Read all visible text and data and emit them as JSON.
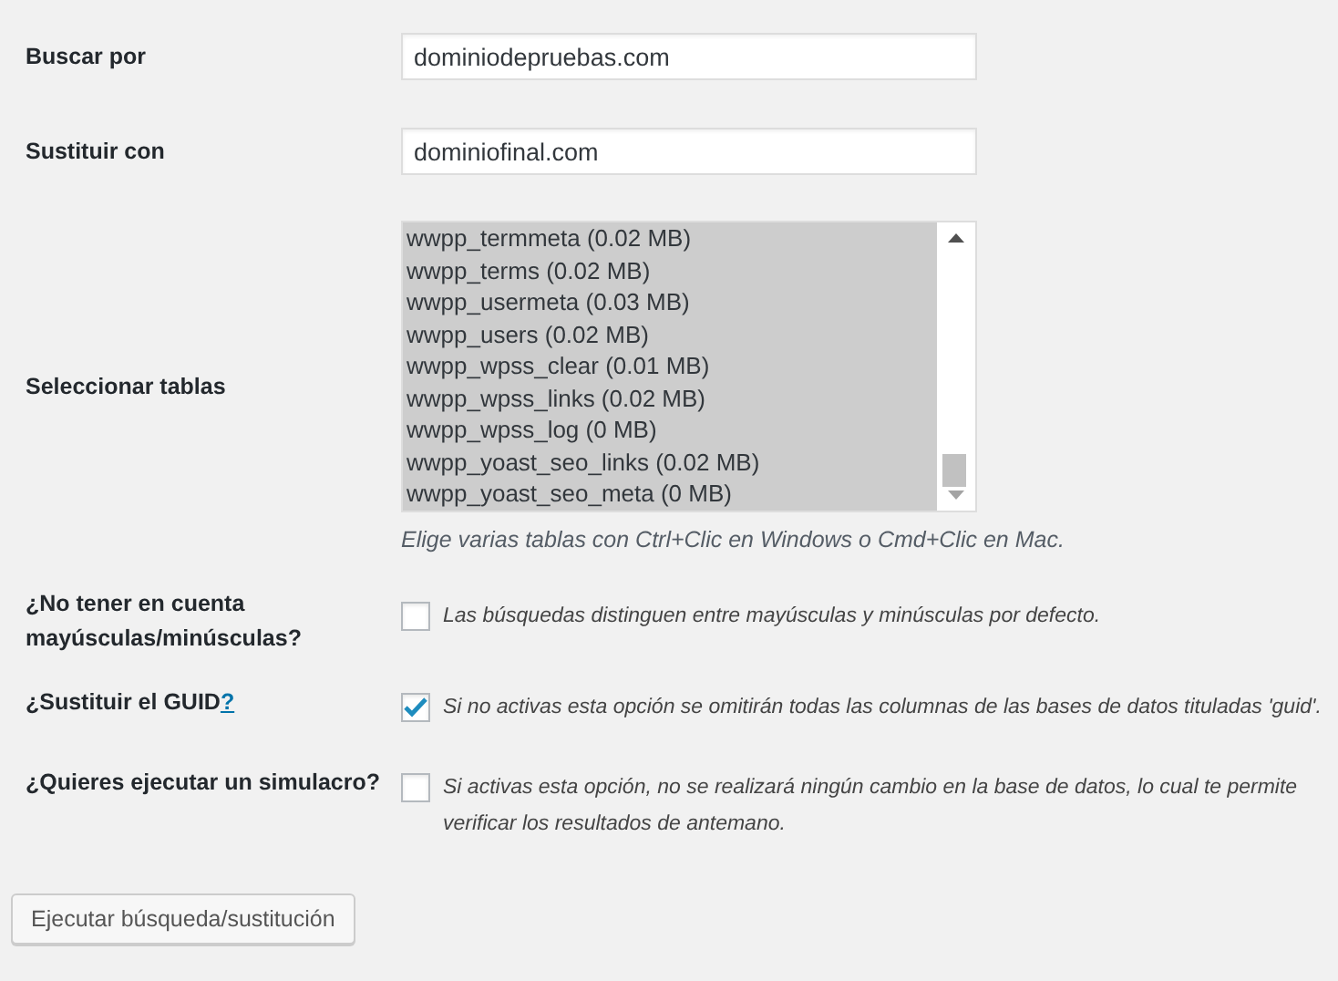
{
  "search_for": {
    "label": "Buscar por",
    "value": "dominiodepruebas.com"
  },
  "replace_with": {
    "label": "Sustituir con",
    "value": "dominiofinal.com"
  },
  "select_tables": {
    "label": "Seleccionar tablas",
    "hint": "Elige varias tablas con Ctrl+Clic en Windows o Cmd+Clic en Mac.",
    "items": [
      {
        "text": "wwpp_termmeta (0.02 MB)",
        "selected": true
      },
      {
        "text": "wwpp_terms (0.02 MB)",
        "selected": true
      },
      {
        "text": "wwpp_usermeta (0.03 MB)",
        "selected": true
      },
      {
        "text": "wwpp_users (0.02 MB)",
        "selected": true
      },
      {
        "text": "wwpp_wpss_clear (0.01 MB)",
        "selected": true
      },
      {
        "text": "wwpp_wpss_links (0.02 MB)",
        "selected": true
      },
      {
        "text": "wwpp_wpss_log (0 MB)",
        "selected": true
      },
      {
        "text": "wwpp_yoast_seo_links (0.02 MB)",
        "selected": true
      },
      {
        "text": "wwpp_yoast_seo_meta (0 MB)",
        "selected": true
      }
    ]
  },
  "options": [
    {
      "label": "¿No tener en cuenta mayúsculas/minúsculas?",
      "description": "Las búsquedas distinguen entre mayúsculas y minúsculas por defecto.",
      "checked": false
    },
    {
      "label": "¿Sustituir el GUID",
      "help_link": "?",
      "description": "Si no activas esta opción se omitirán todas las columnas de las bases de datos tituladas 'guid'.",
      "checked": true
    },
    {
      "label": "¿Quieres ejecutar un simulacro?",
      "description": "Si activas esta opción, no se realizará ningún cambio en la base de datos, lo cual te permite verificar los resultados de antemano.",
      "checked": false
    }
  ],
  "submit_button": "Ejecutar búsqueda/sustitución"
}
